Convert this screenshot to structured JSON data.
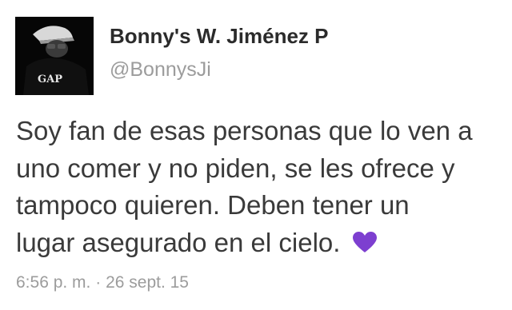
{
  "user": {
    "display_name": "Bonny's W. Jiménez P",
    "handle": "@BonnysJi",
    "avatar_shirt_text": "GAP"
  },
  "tweet": {
    "lines": [
      "Soy fan de esas personas que lo ven a",
      "uno comer y no piden, se les ofrece y",
      "tampoco quieren. Deben tener un",
      "lugar asegurado en el cielo."
    ],
    "emoji": "purple-heart-icon",
    "emoji_color": "#7d3fd0"
  },
  "meta": {
    "time": "6:56 p. m.",
    "separator": "·",
    "date": "26 sept. 15"
  }
}
